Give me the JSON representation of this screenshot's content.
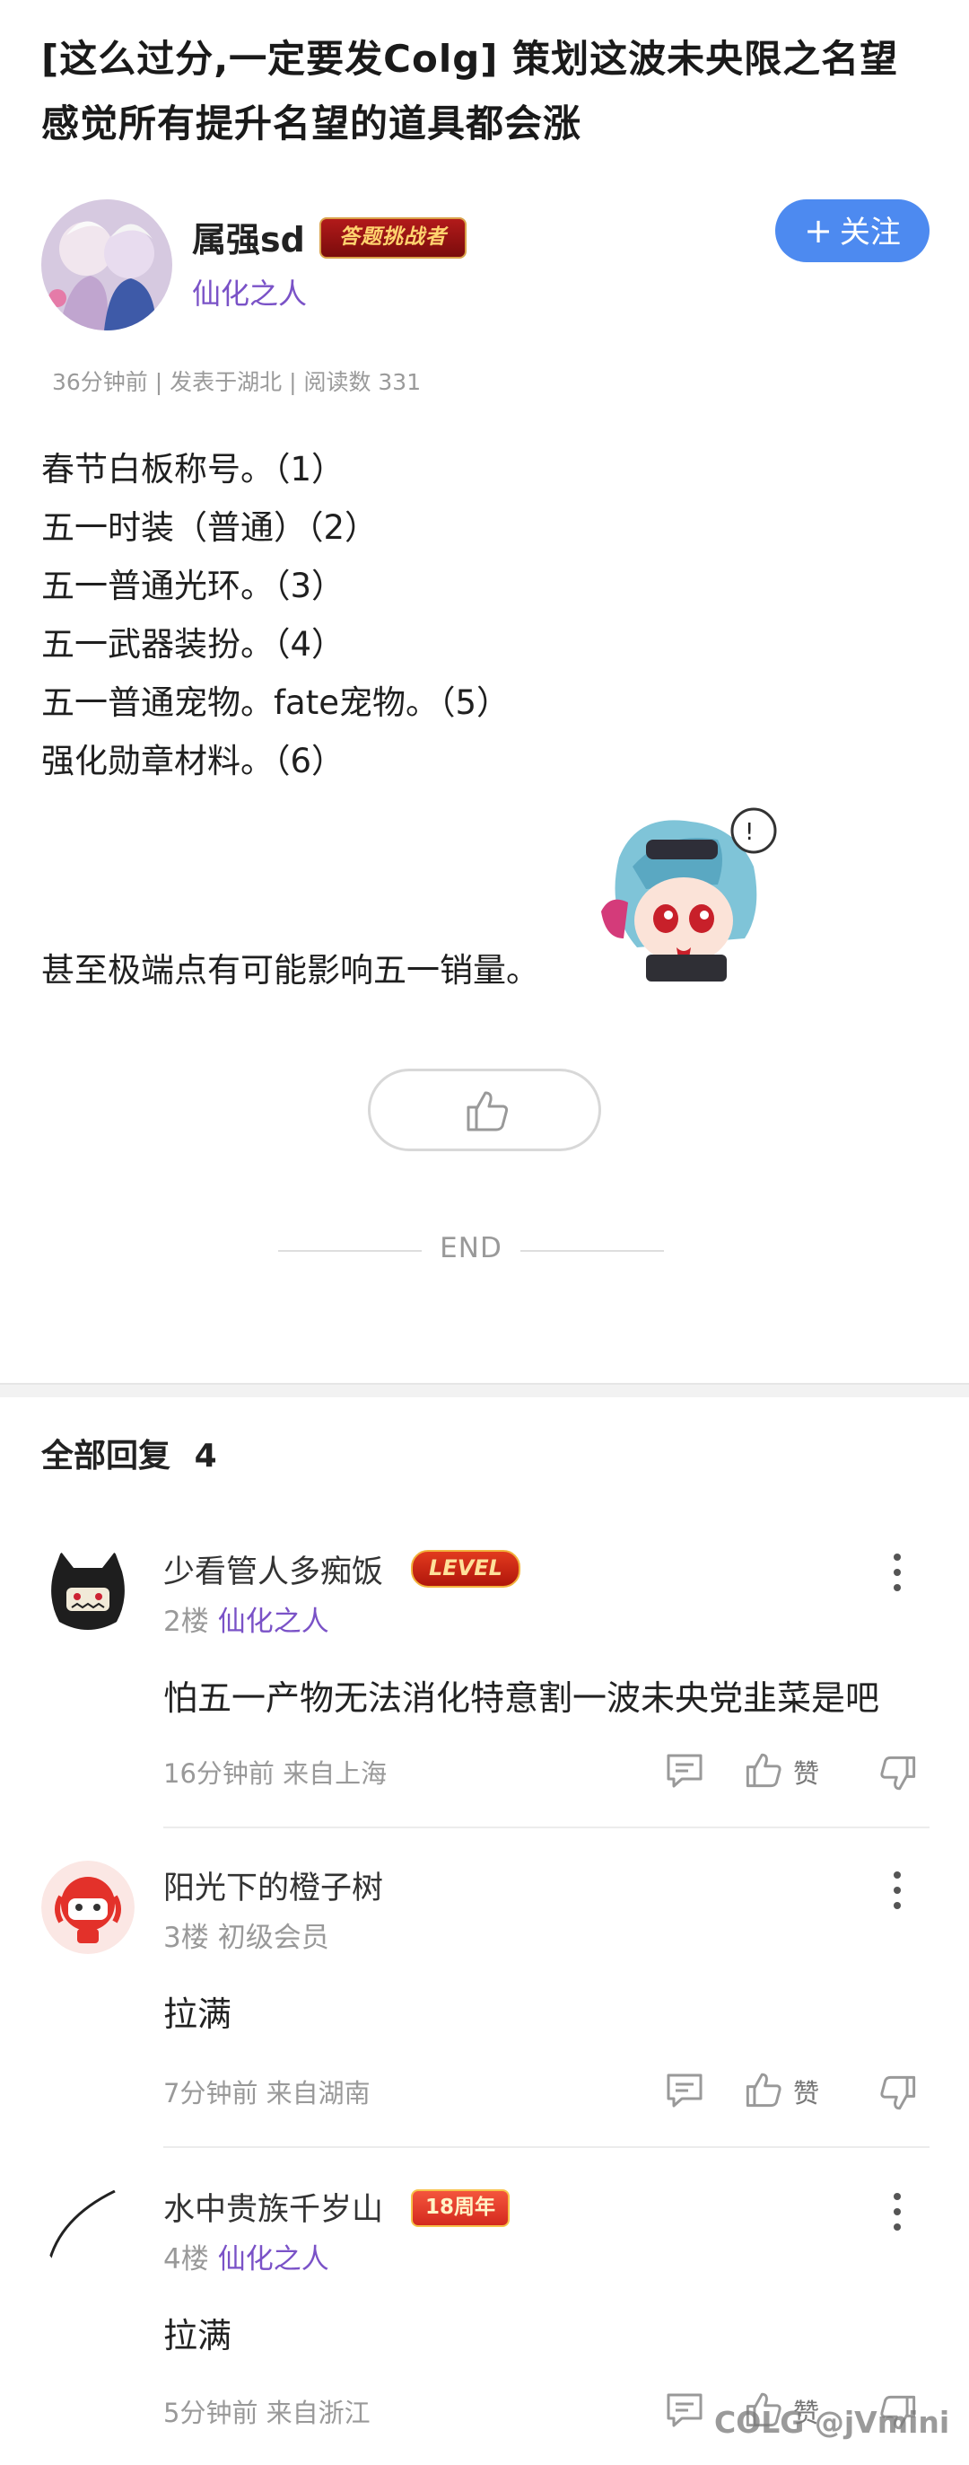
{
  "post": {
    "title": "[这么过分,一定要发Colg] 策划这波未央限之名望 感觉所有提升名望的道具都会涨",
    "author": {
      "name": "属强sd",
      "badge": "答题挑战者",
      "rank": "仙化之人"
    },
    "follow_label": "关注",
    "meta": "36分钟前 | 发表于湖北 | 阅读数 331",
    "content_lines": [
      "春节白板称号。（1）",
      "五一时装（普通）（2）",
      "五一普通光环。（3）",
      "五一武器装扮。（4）",
      "五一普通宠物。fate宠物。（5）",
      "强化勋章材料。（6）"
    ],
    "content_last": "甚至极端点有可能影响五一销量。",
    "end_label": "END"
  },
  "replies": {
    "header": "全部回复",
    "count": "4",
    "items": [
      {
        "name": "少看管人多痴饭",
        "badge": "LEVEL",
        "floor": "2楼",
        "rank": "仙化之人",
        "text": "怕五一产物无法消化特意割一波未央党韭菜是吧",
        "time": "16分钟前 来自上海",
        "like_label": "赞"
      },
      {
        "name": "阳光下的橙子树",
        "floor": "3楼",
        "rank": "初级会员",
        "text": "拉满",
        "time": "7分钟前 来自湖南",
        "like_label": "赞"
      },
      {
        "name": "水中贵族千岁山",
        "badge": "18周年",
        "floor": "4楼",
        "rank": "仙化之人",
        "text": "拉满",
        "time": "5分钟前 来自浙江",
        "like_label": "赞"
      }
    ]
  },
  "watermark": "COLG @jVmini",
  "colors": {
    "accent_blue": "#4d8af0",
    "rank_purple": "#7a52c7"
  },
  "icons": [
    "plus-icon",
    "thumbs-up-icon",
    "comment-icon",
    "thumbs-down-icon",
    "more-icon"
  ]
}
